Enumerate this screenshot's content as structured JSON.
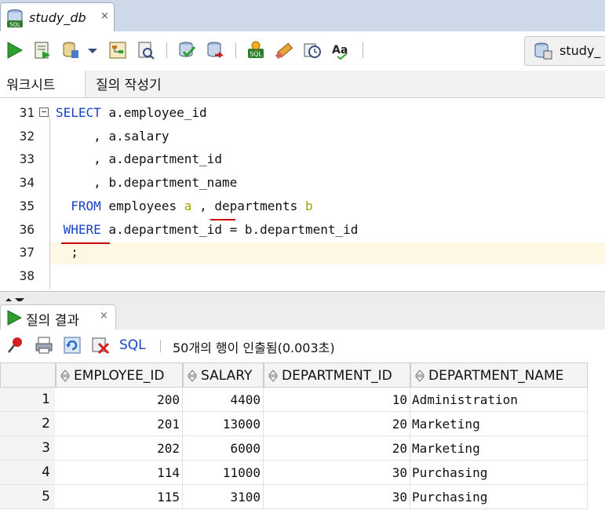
{
  "window": {
    "tab_title": "study_db",
    "close_glyph": "×"
  },
  "toolbar": {
    "icons": [
      "run-statement-icon",
      "run-script-icon",
      "autotrace-icon",
      "dropdown-icon",
      "explain-plan-icon",
      "sql-tuning-icon",
      "commit-icon",
      "rollback-icon",
      "unshared-sql-icon",
      "clear-icon",
      "history-icon",
      "format-case-icon"
    ],
    "connection_label": "study_"
  },
  "worksheet_tabs": {
    "active": "워크시트",
    "other": "질의 작성기"
  },
  "editor": {
    "lines": [
      {
        "num": "31",
        "text": "SELECT a.employee_id"
      },
      {
        "num": "32",
        "text": "     , a.salary"
      },
      {
        "num": "33",
        "text": "     , a.department_id"
      },
      {
        "num": "34",
        "text": "     , b.department_name"
      },
      {
        "num": "35",
        "text": "  FROM employees a , departments b"
      },
      {
        "num": "36",
        "text": " WHERE a.department_id = b.department_id"
      },
      {
        "num": "37",
        "text": "  ;"
      },
      {
        "num": "38",
        "text": ""
      }
    ],
    "keyword_color": "#1a43c9",
    "alias_color": "#a3a300",
    "underline_color": "#cc0000"
  },
  "results": {
    "tab_label": "질의 결과",
    "close_glyph": "×",
    "sql_link": "SQL",
    "status": "50개의 행이 인출됨(0.003초)",
    "columns": [
      "EMPLOYEE_ID",
      "SALARY",
      "DEPARTMENT_ID",
      "DEPARTMENT_NAME"
    ],
    "rows": [
      {
        "n": "1",
        "employee_id": "200",
        "salary": "4400",
        "department_id": "10",
        "department_name": "Administration"
      },
      {
        "n": "2",
        "employee_id": "201",
        "salary": "13000",
        "department_id": "20",
        "department_name": "Marketing"
      },
      {
        "n": "3",
        "employee_id": "202",
        "salary": "6000",
        "department_id": "20",
        "department_name": "Marketing"
      },
      {
        "n": "4",
        "employee_id": "114",
        "salary": "11000",
        "department_id": "30",
        "department_name": "Purchasing"
      },
      {
        "n": "5",
        "employee_id": "115",
        "salary": "3100",
        "department_id": "30",
        "department_name": "Purchasing"
      }
    ]
  }
}
